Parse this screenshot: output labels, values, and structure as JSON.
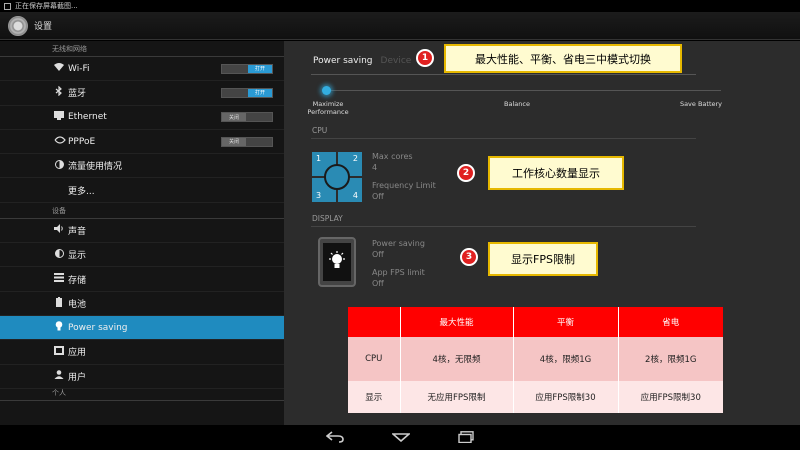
{
  "status_bar": {
    "text": "正在保存屏幕截图..."
  },
  "action_bar": {
    "title": "设置",
    "logo": "settings-gear-icon"
  },
  "sidebar": {
    "header_wireless": "无线和网络",
    "header_device": "设备",
    "header_personal": "个人",
    "items": [
      {
        "label": "Wi-Fi",
        "icon": "wifi-icon",
        "toggle": "打开",
        "toggle_state": "on"
      },
      {
        "label": "蓝牙",
        "icon": "bluetooth-icon",
        "toggle": "打开",
        "toggle_state": "on"
      },
      {
        "label": "Ethernet",
        "icon": "ethernet-icon",
        "toggle": "关闭",
        "toggle_state": "off"
      },
      {
        "label": "PPPoE",
        "icon": "pppoe-icon",
        "toggle": "关闭",
        "toggle_state": "off"
      },
      {
        "label": "流量使用情况",
        "icon": "data-usage-icon"
      },
      {
        "label": "更多..."
      },
      {
        "label": "声音",
        "icon": "sound-icon"
      },
      {
        "label": "显示",
        "icon": "display-icon"
      },
      {
        "label": "存储",
        "icon": "storage-icon"
      },
      {
        "label": "电池",
        "icon": "battery-icon"
      },
      {
        "label": "Power saving",
        "icon": "bulb-icon",
        "active": true
      },
      {
        "label": "应用",
        "icon": "apps-icon"
      },
      {
        "label": "用户",
        "icon": "user-icon"
      }
    ]
  },
  "main": {
    "tabs": {
      "active": "Power saving",
      "inactive": "Device"
    },
    "slider": {
      "labels": [
        "Maximize\nPerformance",
        "Balance",
        "Save Battery"
      ],
      "position": 0
    },
    "cpu": {
      "section": "CPU",
      "quadrants": [
        "1",
        "2",
        "3",
        "4"
      ],
      "max_cores_label": "Max cores",
      "max_cores_value": "4",
      "freq_label": "Frequency Limit",
      "freq_value": "Off"
    },
    "display": {
      "section": "DISPLAY",
      "ps_label": "Power saving",
      "ps_value": "Off",
      "fps_label": "App FPS limit",
      "fps_value": "Off"
    }
  },
  "callouts": [
    {
      "num": "1",
      "text": "最大性能、平衡、省电三中模式切换"
    },
    {
      "num": "2",
      "text": "工作核心数量显示"
    },
    {
      "num": "3",
      "text": "显示FPS限制"
    }
  ],
  "table": {
    "headers": [
      "",
      "最大性能",
      "平衡",
      "省电"
    ],
    "rows": [
      [
        "CPU",
        "4核，无限频",
        "4核，限频1G",
        "2核，限频1G"
      ],
      [
        "显示",
        "无应用FPS限制",
        "应用FPS限制30",
        "应用FPS限制30"
      ]
    ]
  },
  "colors": {
    "accent": "#1f8bbf",
    "callout_red": "#e02020",
    "table_header": "#ff0000"
  }
}
